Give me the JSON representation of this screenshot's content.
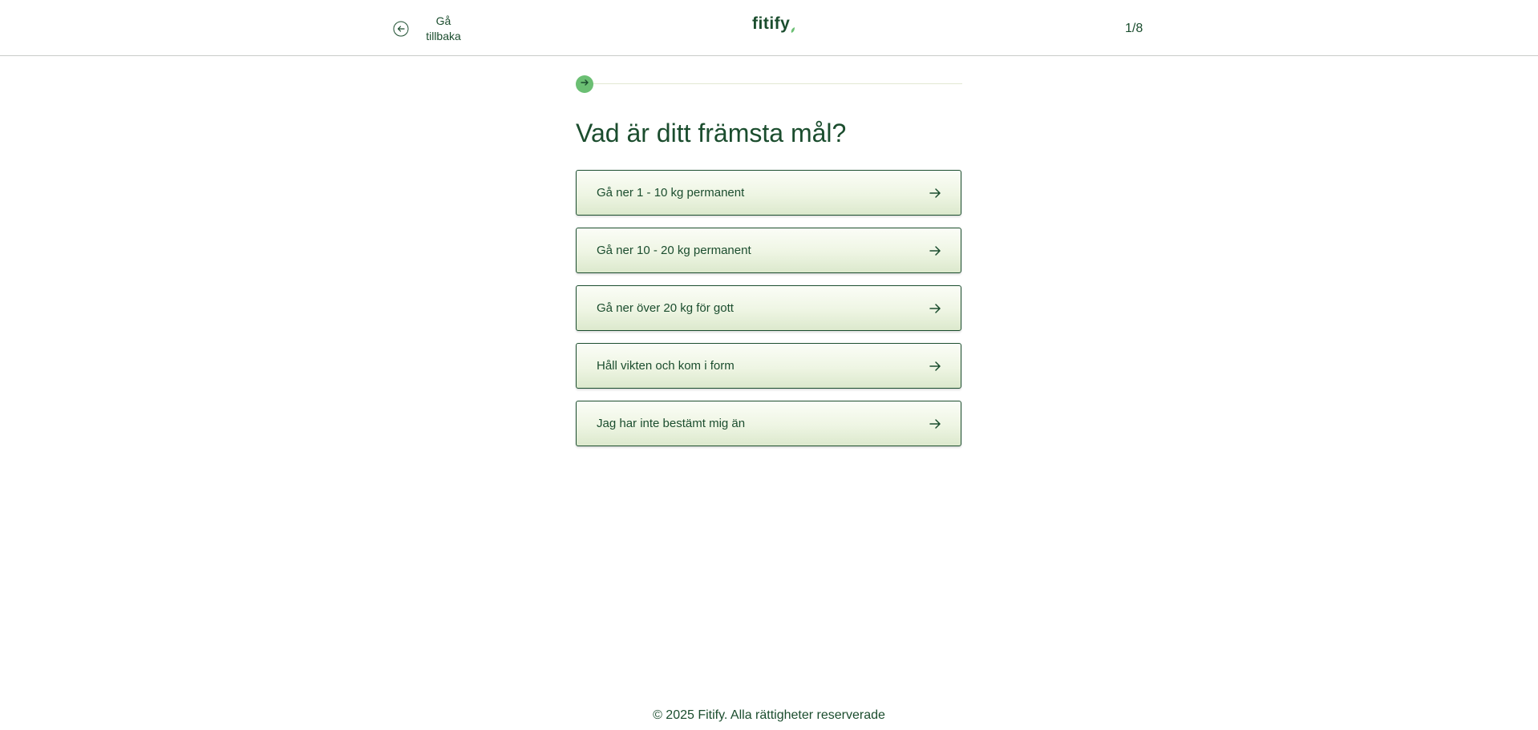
{
  "header": {
    "back_label": "Gå tillbaka",
    "logo_text": "fitify",
    "step_counter": "1/8"
  },
  "progress": {
    "current_step": 1,
    "total_steps": 8
  },
  "question": {
    "title": "Vad är ditt främsta mål?"
  },
  "options": [
    {
      "label": "Gå ner 1 - 10 kg permanent",
      "icon": "arrow-right-icon"
    },
    {
      "label": "Gå ner 10 - 20 kg permanent",
      "icon": "arrow-right-icon"
    },
    {
      "label": "Gå ner över 20 kg för gott",
      "icon": "arrow-right-icon"
    },
    {
      "label": "Håll vikten och kom i form",
      "icon": "arrow-right-icon"
    },
    {
      "label": "Jag har inte bestämt mig än",
      "icon": "arrow-right-icon"
    }
  ],
  "footer": {
    "copyright": "© 2025 Fitify. Alla rättigheter reserverade"
  },
  "colors": {
    "brand_green": "#1b4d2e",
    "progress_dot": "#6bbf73",
    "option_gradient_bottom": "#dce9cd"
  }
}
